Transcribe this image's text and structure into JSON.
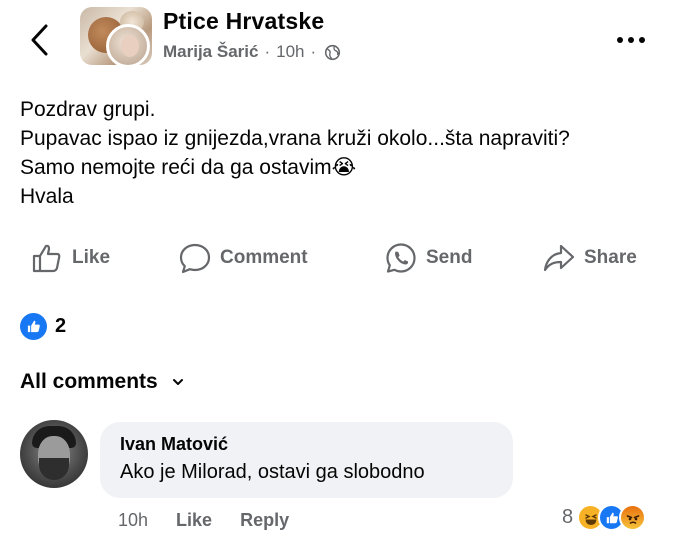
{
  "header": {
    "group_name": "Ptice Hrvatske",
    "author": "Marija Šarić",
    "separator": "·",
    "time": "10h",
    "separator2": "·",
    "privacy_icon": "globe-icon",
    "back_icon": "chevron-left-icon",
    "more_icon": "more-horizontal-icon"
  },
  "post": {
    "lines": [
      "Pozdrav grupi.",
      "Pupavac ispao iz gnijezda,vrana kruži okolo...šta napraviti?",
      "Samo nemojte reći da ga ostavim😭",
      "Hvala"
    ]
  },
  "actions": {
    "like": "Like",
    "comment": "Comment",
    "send": "Send",
    "share": "Share"
  },
  "reactions": {
    "count": "2",
    "type": "like"
  },
  "comments_section": {
    "filter_label": "All comments"
  },
  "comment": {
    "author": "Ivan Matović",
    "text": "Ako je Milorad, ostavi ga slobodno",
    "time": "10h",
    "like_label": "Like",
    "reply_label": "Reply",
    "reaction_count": "8",
    "reaction_types": [
      "haha",
      "like",
      "angry"
    ]
  },
  "colors": {
    "accent": "#1877f2",
    "secondary_text": "#65676b",
    "bubble": "#f0f2f5"
  }
}
